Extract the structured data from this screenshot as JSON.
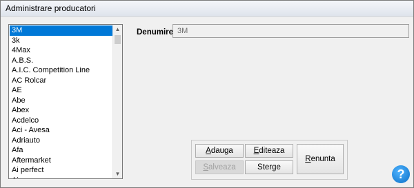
{
  "window": {
    "title": "Administrare producatori"
  },
  "list": {
    "items": [
      "3M",
      "3k",
      "4Max",
      "A.B.S.",
      "A.I.C. Competition Line",
      "AC Rolcar",
      "AE",
      "Abe",
      "Abex",
      "Acdelco",
      "Aci - Avesa",
      "Adriauto",
      "Afa",
      "Aftermarket",
      "Ai perfect",
      "Aja"
    ],
    "selected_index": 0
  },
  "form": {
    "denumire_label": "Denumire:",
    "denumire_value": "3M"
  },
  "buttons": {
    "adauga_pre": "",
    "adauga_key": "A",
    "adauga_post": "dauga",
    "editeaza_pre": "",
    "editeaza_key": "E",
    "editeaza_post": "diteaza",
    "salveaza_pre": "",
    "salveaza_key": "S",
    "salveaza_post": "alveaza",
    "sterge_pre": "",
    "sterge_key": "",
    "sterge_post": "Sterge",
    "renunta_pre": "",
    "renunta_key": "R",
    "renunta_post": "enunta"
  },
  "help": {
    "glyph": "?"
  },
  "scrollbar": {
    "up_glyph": "▲",
    "down_glyph": "▼"
  }
}
